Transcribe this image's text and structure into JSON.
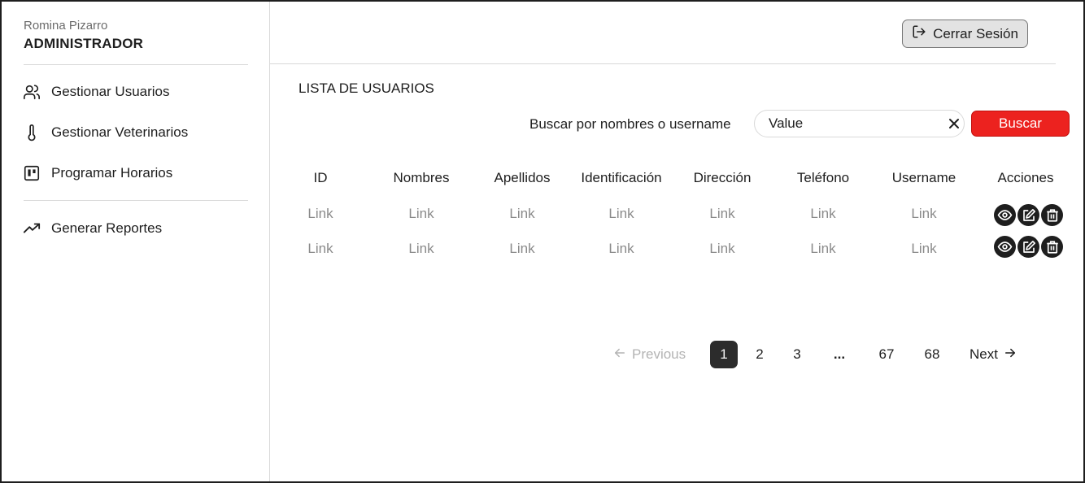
{
  "user": {
    "name": "Romina Pizarro",
    "role": "ADMINISTRADOR"
  },
  "sidebar": {
    "items": [
      {
        "label": "Gestionar Usuarios",
        "icon": "users-icon"
      },
      {
        "label": "Gestionar Veterinarios",
        "icon": "thermometer-icon"
      },
      {
        "label": "Programar Horarios",
        "icon": "board-icon"
      },
      {
        "label": "Generar Reportes",
        "icon": "trending-up-icon"
      }
    ]
  },
  "header": {
    "logout_label": "Cerrar Sesión",
    "logout_icon": "log-out-icon"
  },
  "main": {
    "title": "LISTA DE USUARIOS",
    "search": {
      "label": "Buscar por nombres o username",
      "value": "Value",
      "button": "Buscar"
    }
  },
  "table": {
    "headers": [
      "ID",
      "Nombres",
      "Apellidos",
      "Identificación",
      "Dirección",
      "Teléfono",
      "Username",
      "Acciones"
    ],
    "rows": [
      [
        "Link",
        "Link",
        "Link",
        "Link",
        "Link",
        "Link",
        "Link"
      ],
      [
        "Link",
        "Link",
        "Link",
        "Link",
        "Link",
        "Link",
        "Link"
      ]
    ],
    "action_icons": [
      "eye-icon",
      "edit-icon",
      "trash-icon"
    ]
  },
  "pagination": {
    "previous": "Previous",
    "pages": [
      "1",
      "2",
      "3",
      "...",
      "67",
      "68"
    ],
    "current": "1",
    "next": "Next"
  },
  "colors": {
    "accent": "#ec221f",
    "active_page": "#2c2c2c",
    "link_text": "#8a8a8a"
  }
}
